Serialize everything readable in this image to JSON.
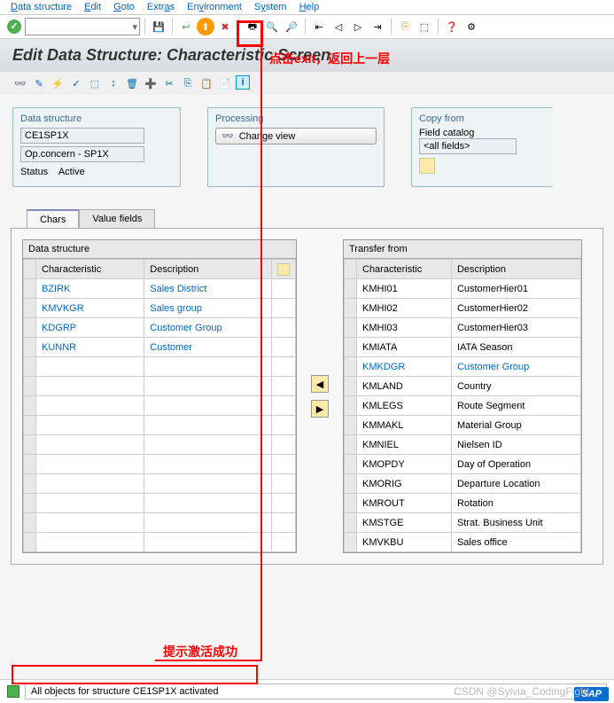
{
  "menu": {
    "items": [
      "Data structure",
      "Edit",
      "Goto",
      "Extras",
      "Environment",
      "System",
      "Help"
    ]
  },
  "title": "Edit Data Structure: Characteristic Screen",
  "panel1": {
    "title": "Data structure",
    "val1": "CE1SP1X",
    "val2": "Op.concern - SP1X",
    "status_lbl": "Status",
    "status_val": "Active"
  },
  "panel2": {
    "title": "Processing",
    "btn": "Change view"
  },
  "panel3": {
    "title": "Copy from",
    "lbl": "Field catalog",
    "sel": "<all fields>"
  },
  "tabs": {
    "t1": "Chars",
    "t2": "Value fields"
  },
  "left": {
    "title": "Data structure",
    "h1": "Characteristic",
    "h2": "Description",
    "rows": [
      {
        "c": "BZIRK",
        "d": "Sales District"
      },
      {
        "c": "KMVKGR",
        "d": "Sales group"
      },
      {
        "c": "KDGRP",
        "d": "Customer Group"
      },
      {
        "c": "KUNNR",
        "d": "Customer"
      }
    ]
  },
  "right": {
    "title": "Transfer from",
    "h1": "Characteristic",
    "h2": "Description",
    "rows": [
      {
        "c": "KMHI01",
        "d": "CustomerHier01",
        "link": false
      },
      {
        "c": "KMHI02",
        "d": "CustomerHier02",
        "link": false
      },
      {
        "c": "KMHI03",
        "d": "CustomerHier03",
        "link": false
      },
      {
        "c": "KMIATA",
        "d": "IATA Season",
        "link": false
      },
      {
        "c": "KMKDGR",
        "d": "Customer Group",
        "link": true
      },
      {
        "c": "KMLAND",
        "d": "Country",
        "link": false
      },
      {
        "c": "KMLEGS",
        "d": "Route Segment",
        "link": false
      },
      {
        "c": "KMMAKL",
        "d": "Material Group",
        "link": false
      },
      {
        "c": "KMNIEL",
        "d": "Nielsen ID",
        "link": false
      },
      {
        "c": "KMOPDY",
        "d": "Day of Operation",
        "link": false
      },
      {
        "c": "KMORIG",
        "d": "Departure Location",
        "link": false
      },
      {
        "c": "KMROUT",
        "d": "Rotation",
        "link": false
      },
      {
        "c": "KMSTGE",
        "d": "Strat. Business Unit",
        "link": false
      },
      {
        "c": "KMVKBU",
        "d": "Sales office",
        "link": false
      }
    ]
  },
  "status": "All objects for structure CE1SP1X activated",
  "ann": {
    "a1": "点击exit，返回上一层",
    "a2": "提示激活成功"
  },
  "watermark": "CSDN @Sylvia_CodingFight"
}
